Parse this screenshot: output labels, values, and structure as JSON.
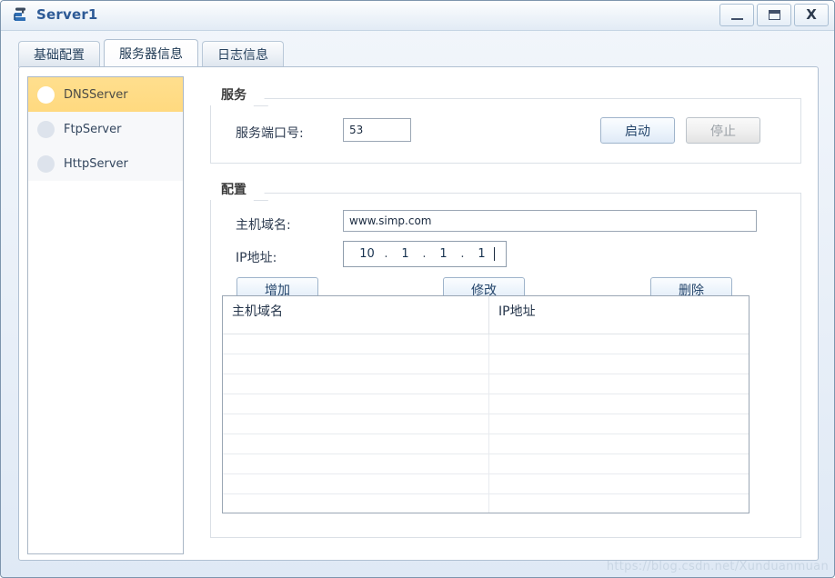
{
  "window": {
    "title": "Server1",
    "icon": "server-device-icon",
    "controls": {
      "minimize": "—",
      "maximize": "□",
      "close": "X"
    }
  },
  "tabs": [
    {
      "label": "基础配置",
      "active": false
    },
    {
      "label": "服务器信息",
      "active": true
    },
    {
      "label": "日志信息",
      "active": false
    }
  ],
  "sidebar": {
    "items": [
      {
        "label": "DNSServer",
        "selected": true
      },
      {
        "label": "FtpServer",
        "selected": false
      },
      {
        "label": "HttpServer",
        "selected": false
      }
    ]
  },
  "service_group": {
    "title": "服务",
    "port_label": "服务端口号:",
    "port_value": "53",
    "start_button": "启动",
    "stop_button": "停止"
  },
  "config_group": {
    "title": "配置",
    "domain_label": "主机域名:",
    "domain_value": "www.simp.com",
    "ip_label": "IP地址:",
    "ip_octets": [
      "10",
      "1",
      "1",
      "1"
    ],
    "ip_separator": ".",
    "add_button": "增加",
    "modify_button": "修改",
    "delete_button": "删除",
    "table": {
      "columns": [
        "主机域名",
        "IP地址"
      ],
      "rows": [
        [
          "",
          ""
        ],
        [
          "",
          ""
        ],
        [
          "",
          ""
        ],
        [
          "",
          ""
        ],
        [
          "",
          ""
        ],
        [
          "",
          ""
        ],
        [
          "",
          ""
        ],
        [
          "",
          ""
        ],
        [
          "",
          ""
        ]
      ]
    }
  },
  "watermark": "https://blog.csdn.net/Xunduanmuan",
  "colors": {
    "accent": "#2d5a96",
    "selection": "#ffd97f",
    "window_border": "#7d95ad"
  }
}
